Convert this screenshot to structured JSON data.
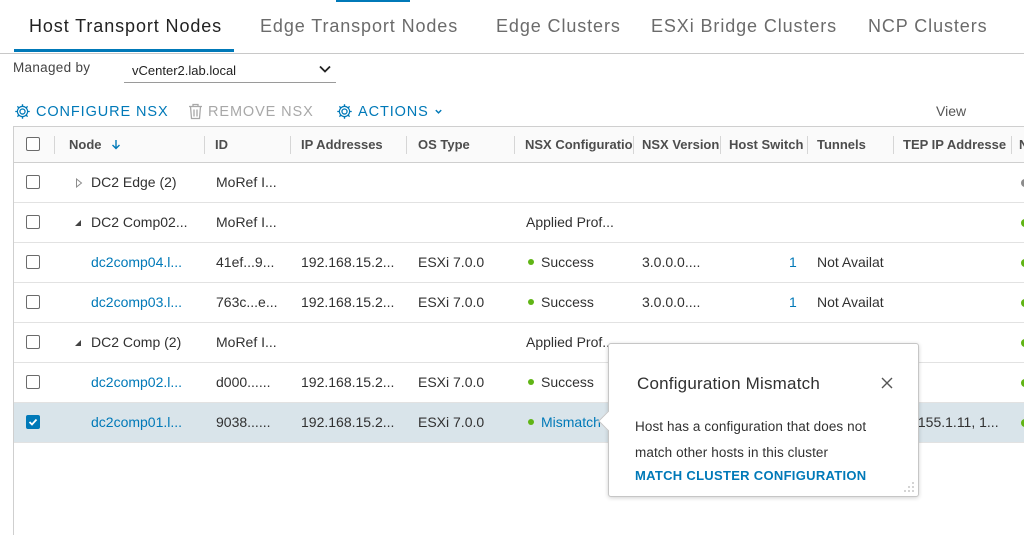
{
  "tabs": [
    {
      "label": "Host Transport Nodes",
      "active": true
    },
    {
      "label": "Edge Transport Nodes",
      "active": false
    },
    {
      "label": "Edge Clusters",
      "active": false
    },
    {
      "label": "ESXi Bridge Clusters",
      "active": false
    },
    {
      "label": "NCP Clusters",
      "active": false
    }
  ],
  "managed_by": {
    "label": "Managed by",
    "value": "vCenter2.lab.local",
    "icon": "chevron-down-icon"
  },
  "toolbar": {
    "configure": {
      "label": "CONFIGURE NSX",
      "icon": "gear-icon"
    },
    "remove": {
      "label": "REMOVE NSX",
      "icon": "trash-icon"
    },
    "actions": {
      "label": "ACTIONS",
      "icon": "gear-icon"
    },
    "view_label": "View"
  },
  "grid": {
    "columns": [
      "Node",
      "ID",
      "IP Addresses",
      "OS Type",
      "NSX Configuratio",
      "NSX Version",
      "Host Switch",
      "Tunnels",
      "TEP IP Addresse",
      "N"
    ],
    "sort_icon": "arrow-down-icon",
    "rows": [
      {
        "kind": "group",
        "expanded": false,
        "checked": false,
        "node": "DC2 Edge (2)",
        "id": "MoRef I...",
        "ip": "",
        "os": "",
        "nsx_config": "",
        "nsx_version": "",
        "host_switch": "",
        "tunnels": "",
        "tep": ""
      },
      {
        "kind": "group",
        "expanded": true,
        "checked": false,
        "node": "DC2 Comp02...",
        "id": "MoRef I...",
        "ip": "",
        "os": "",
        "nsx_config": "Applied Prof...",
        "nsx_version": "",
        "host_switch": "",
        "tunnels": "",
        "tep": ""
      },
      {
        "kind": "host",
        "checked": false,
        "node": "dc2comp04.l...",
        "id": "41ef...9...",
        "ip": "192.168.15.2...",
        "os": "ESXi 7.0.0",
        "nsx_config": "Success",
        "nsx_version": "3.0.0.0....",
        "host_switch": "1",
        "tunnels": "Not Availat",
        "tep": ""
      },
      {
        "kind": "host",
        "checked": false,
        "node": "dc2comp03.l...",
        "id": "763c...e...",
        "ip": "192.168.15.2...",
        "os": "ESXi 7.0.0",
        "nsx_config": "Success",
        "nsx_version": "3.0.0.0....",
        "host_switch": "1",
        "tunnels": "Not Availat",
        "tep": ""
      },
      {
        "kind": "group",
        "expanded": true,
        "checked": false,
        "node": "DC2 Comp (2)",
        "id": "MoRef I...",
        "ip": "",
        "os": "",
        "nsx_config": "Applied Prof...",
        "nsx_version": "",
        "host_switch": "",
        "tunnels": "",
        "tep": ""
      },
      {
        "kind": "host",
        "checked": false,
        "node": "dc2comp02.l...",
        "id": "d000......",
        "ip": "192.168.15.2...",
        "os": "ESXi 7.0.0",
        "nsx_config": "Success",
        "nsx_version": "",
        "host_switch": "",
        "tunnels": "",
        "tep": ""
      },
      {
        "kind": "host",
        "checked": true,
        "node": "dc2comp01.l...",
        "id": "9038......",
        "ip": "192.168.15.2...",
        "os": "ESXi 7.0.0",
        "nsx_config": "Mismatch",
        "nsx_version": "",
        "host_switch": "",
        "tunnels": "",
        "tep": ".155.1.11, 1..."
      }
    ]
  },
  "popover": {
    "title": "Configuration Mismatch",
    "body": "Host has a configuration that does not match other hosts in this cluster",
    "action": "MATCH CLUSTER CONFIGURATION",
    "close_icon": "close-icon"
  },
  "colors": {
    "accent": "#0079b8",
    "success": "#60b515",
    "selected_row": "#d9e4ea",
    "grey_status": "#8c8c8c"
  }
}
